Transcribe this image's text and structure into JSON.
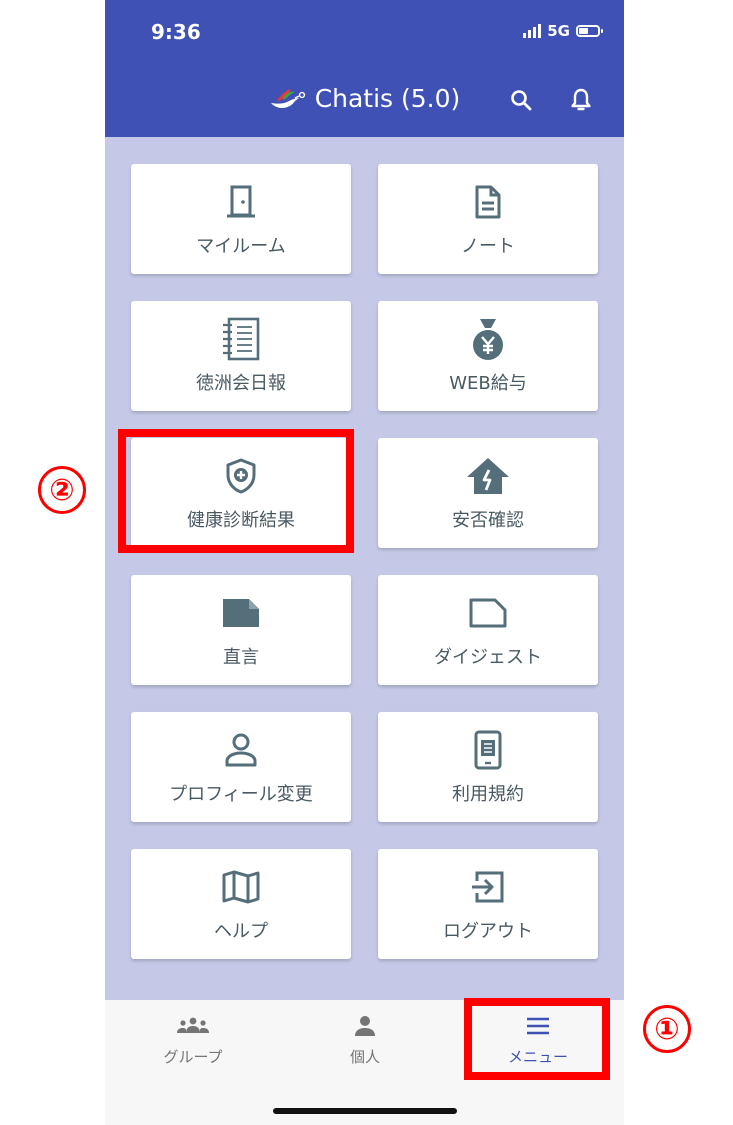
{
  "status_bar": {
    "time": "9:36",
    "network": "5G"
  },
  "app_bar": {
    "title": "Chatis (5.0)"
  },
  "menu_tiles": [
    {
      "label": "マイルーム",
      "icon": "door-icon"
    },
    {
      "label": "ノート",
      "icon": "document-icon"
    },
    {
      "label": "徳洲会日報",
      "icon": "notebook-icon"
    },
    {
      "label": "WEB給与",
      "icon": "money-bag-yen-icon"
    },
    {
      "label": "健康診断結果",
      "icon": "shield-plus-icon"
    },
    {
      "label": "安否確認",
      "icon": "house-broken-icon"
    },
    {
      "label": "直言",
      "icon": "folded-note-filled-icon"
    },
    {
      "label": "ダイジェスト",
      "icon": "folded-note-outline-icon"
    },
    {
      "label": "プロフィール変更",
      "icon": "person-outline-icon"
    },
    {
      "label": "利用規約",
      "icon": "phone-doc-icon"
    },
    {
      "label": "ヘルプ",
      "icon": "map-icon"
    },
    {
      "label": "ログアウト",
      "icon": "logout-icon"
    }
  ],
  "bottom_nav": [
    {
      "label": "グループ",
      "icon": "group-icon",
      "active": false
    },
    {
      "label": "個人",
      "icon": "person-icon",
      "active": false
    },
    {
      "label": "メニュー",
      "icon": "menu-icon",
      "active": true
    }
  ],
  "annotations": [
    {
      "marker": "①",
      "target": "メニュー"
    },
    {
      "marker": "②",
      "target": "健康診断結果"
    }
  ],
  "colors": {
    "primary": "#3f51b5",
    "background": "#c5c9e7",
    "icon": "#546e7a",
    "highlight": "#ff0000"
  }
}
